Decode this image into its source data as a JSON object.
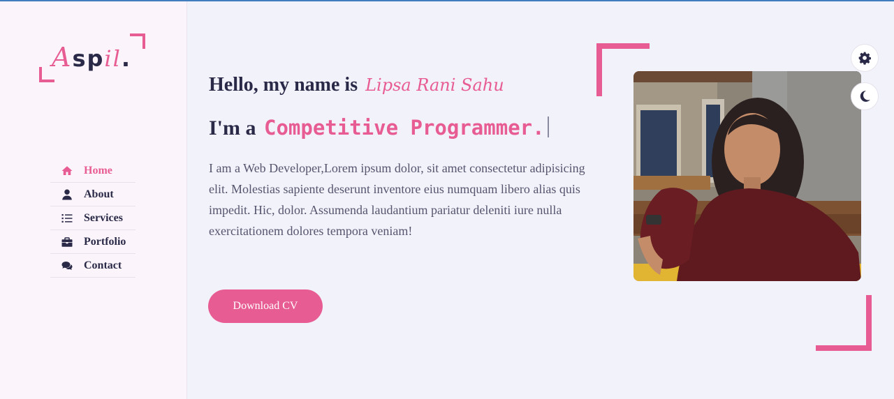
{
  "brand": {
    "logo_a": "A",
    "logo_sp": "sp",
    "logo_il": "il",
    "logo_dot": ".",
    "accent": "#e85c94",
    "dark": "#2a2a48"
  },
  "nav": {
    "items": [
      {
        "label": "Home",
        "icon": "home-icon",
        "active": true
      },
      {
        "label": "About",
        "icon": "user-icon"
      },
      {
        "label": "Services",
        "icon": "list-icon"
      },
      {
        "label": "Portfolio",
        "icon": "briefcase-icon"
      },
      {
        "label": "Contact",
        "icon": "comments-icon"
      }
    ]
  },
  "hero": {
    "greeting": "Hello, my name is",
    "name": "Lipsa Rani Sahu",
    "role_prefix": "I'm a",
    "role_typed": "Competitive Programmer.",
    "description": "I am a Web Developer,Lorem ipsum dolor, sit amet consectetur adipisicing elit. Molestias sapiente deserunt inventore eius numquam libero alias quis impedit. Hic, dolor. Assumenda laudantium pariatur deleniti iure nulla exercitationem dolores tempora veniam!",
    "cta_label": "Download CV"
  },
  "controls": {
    "settings_icon": "gear-icon",
    "theme_icon": "moon-icon"
  }
}
